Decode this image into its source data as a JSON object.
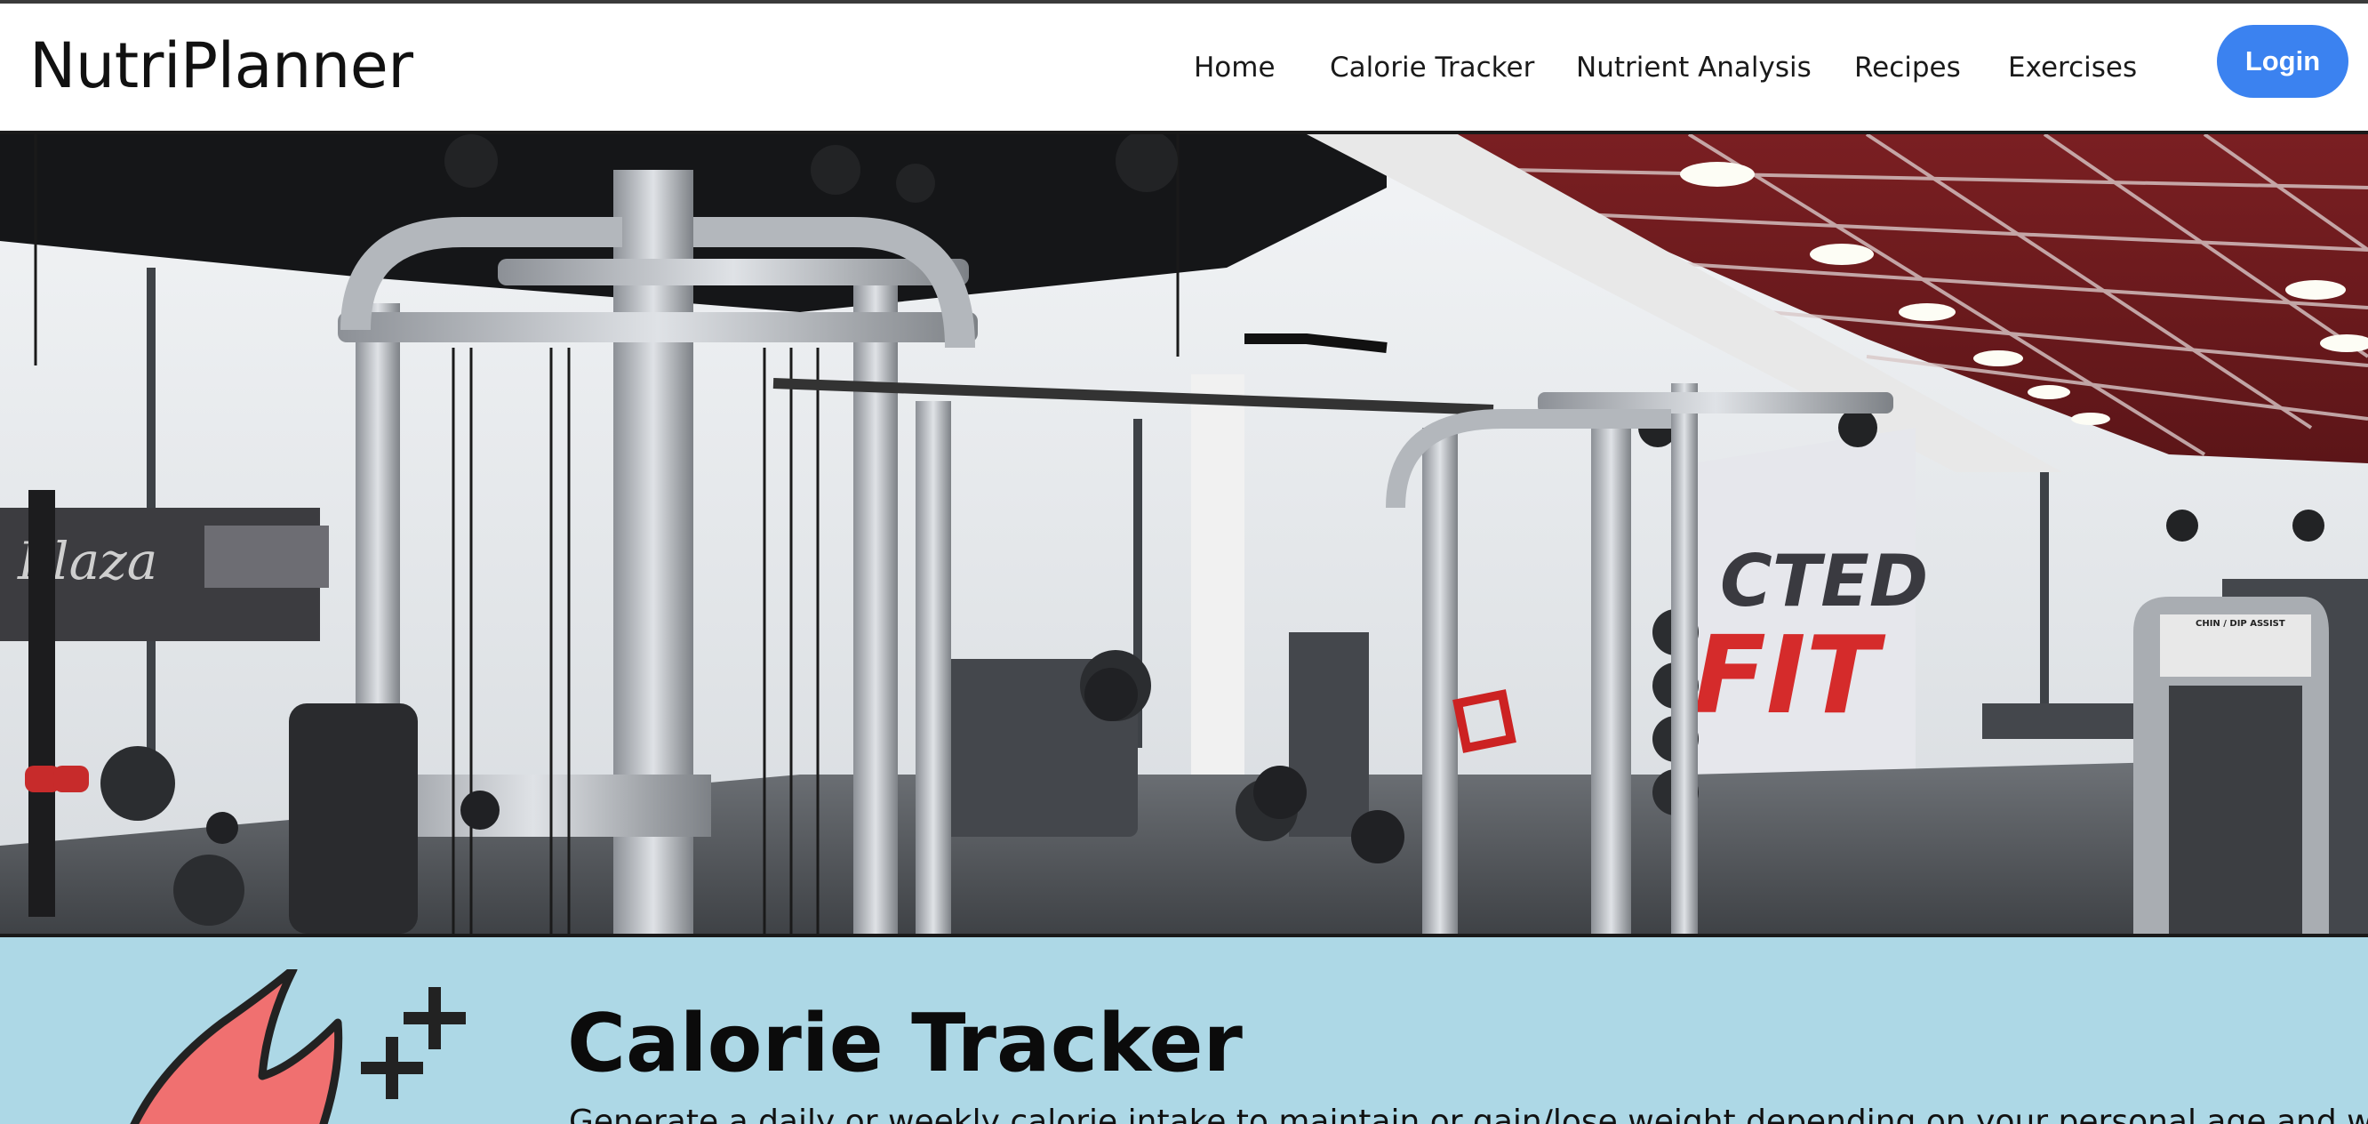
{
  "header": {
    "brand": "NutriPlanner",
    "nav": [
      "Home",
      "Calorie Tracker",
      "Nutrient Analysis",
      "Recipes",
      "Exercises"
    ],
    "login_label": "Login",
    "accent_color": "#3b82f0"
  },
  "hero": {
    "image": "gym-interior-photo",
    "sign_text": [
      "CTED",
      "FIT"
    ],
    "panel_text": "CHIN / DIP ASSIST"
  },
  "feature": {
    "background_color": "#add8e6",
    "icon": "flame-plus-icon",
    "title": "Calorie Tracker",
    "description": "Generate a daily or weekly calorie intake to maintain or gain/lose weight depending on your personal age and weight"
  }
}
